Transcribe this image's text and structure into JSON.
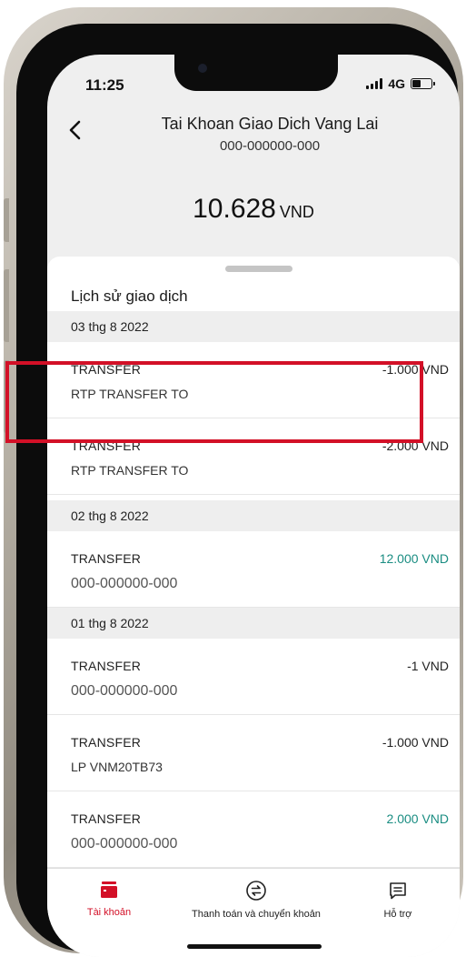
{
  "status_bar": {
    "time": "11:25",
    "network": "4G"
  },
  "header": {
    "account_name": "Tai Khoan Giao Dich Vang Lai",
    "account_number": "000-000000-000",
    "balance_amount": "10.628",
    "balance_currency": "VND"
  },
  "history": {
    "title": "Lịch sử giao dịch",
    "groups": [
      {
        "date": "03 thg 8 2022",
        "transactions": [
          {
            "type": "TRANSFER",
            "description": "RTP TRANSFER TO",
            "amount": "-1.000 VND"
          },
          {
            "type": "TRANSFER",
            "description": "RTP TRANSFER TO",
            "amount": "-2.000 VND"
          }
        ]
      },
      {
        "date": "02 thg 8 2022",
        "transactions": [
          {
            "type": "TRANSFER",
            "description": "000-000000-000",
            "amount": "12.000 VND"
          }
        ]
      },
      {
        "date": "01 thg 8 2022",
        "transactions": [
          {
            "type": "TRANSFER",
            "description": "000-000000-000",
            "amount": "-1 VND"
          },
          {
            "type": "TRANSFER",
            "description": "LP VNM20TB73",
            "amount": "-1.000 VND"
          },
          {
            "type": "TRANSFER",
            "description": "000-000000-000",
            "amount": "2.000 VND"
          }
        ]
      }
    ]
  },
  "tabbar": {
    "items": [
      {
        "label": "Tài khoản",
        "icon": "wallet-icon"
      },
      {
        "label": "Thanh toán và chuyển khoản",
        "icon": "transfer-icon"
      },
      {
        "label": "Hỗ trợ",
        "icon": "chat-icon"
      }
    ]
  },
  "colors": {
    "accent": "#d31027",
    "credit": "#1a8d82"
  }
}
